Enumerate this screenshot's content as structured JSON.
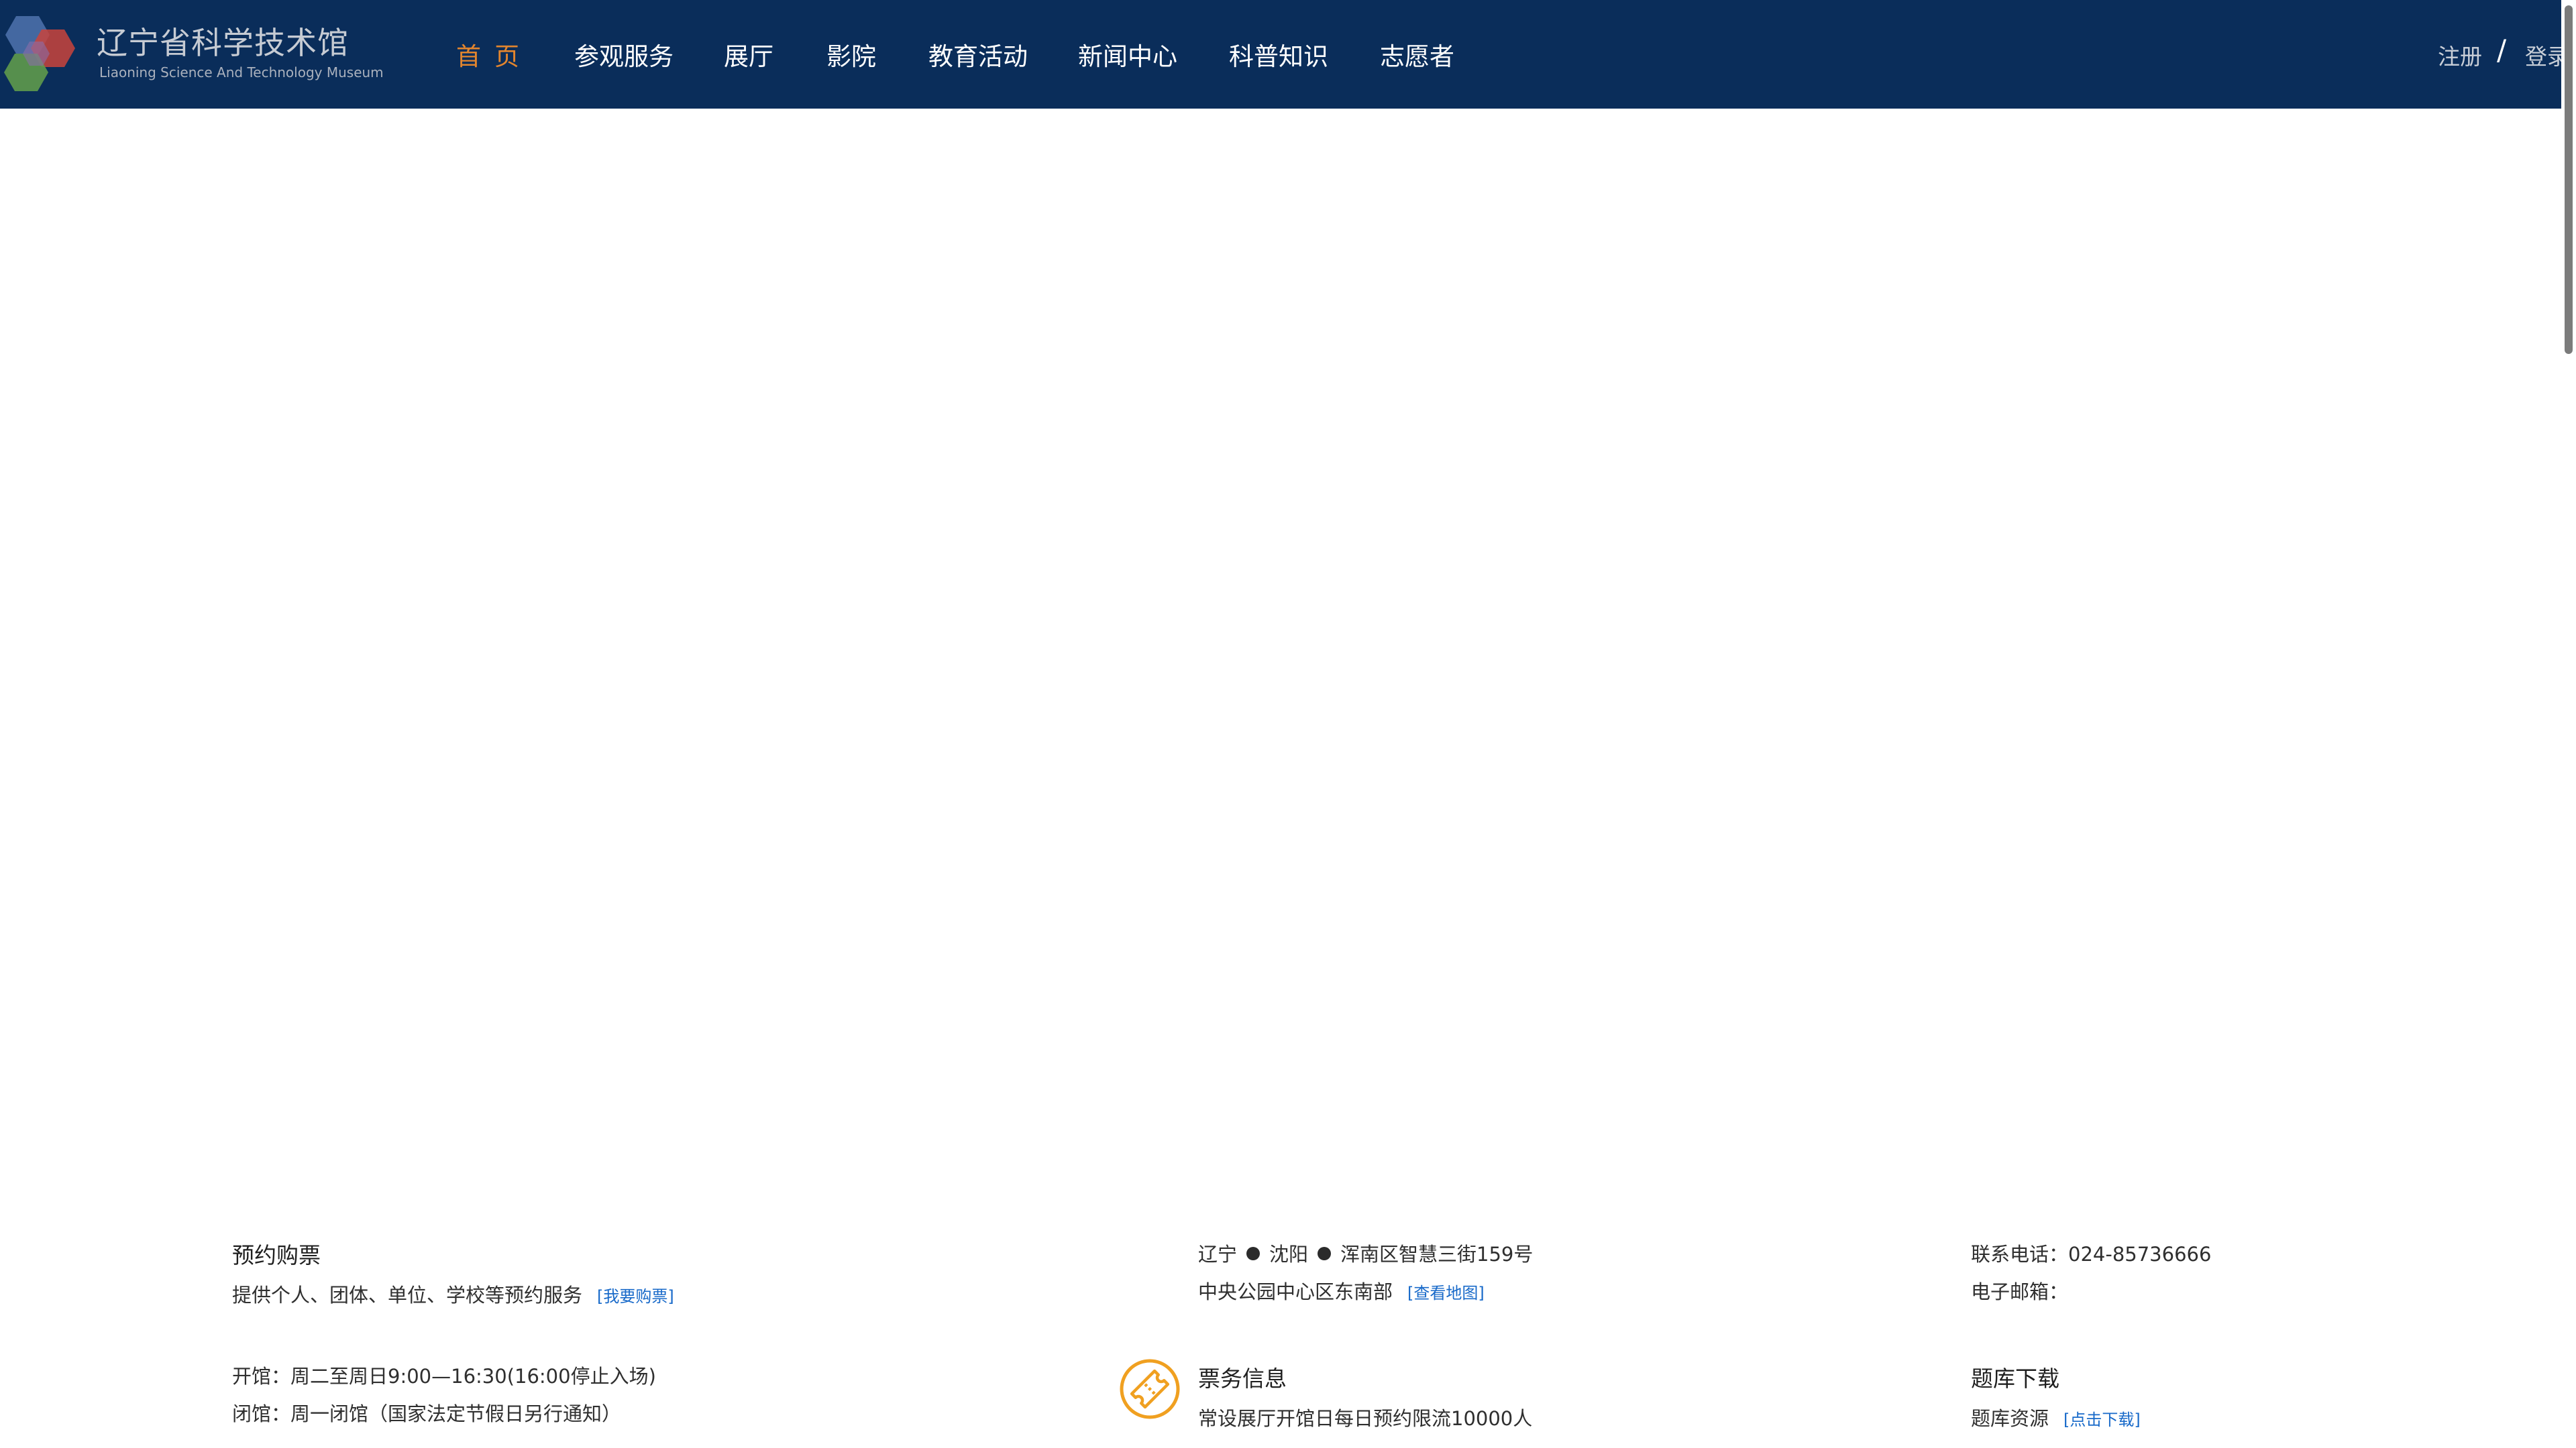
{
  "header": {
    "logo_title": "辽宁省科学技术馆",
    "logo_subtitle": "Liaoning Science And Technology Museum",
    "nav": [
      {
        "label": "首页"
      },
      {
        "label": "参观服务"
      },
      {
        "label": "展厅"
      },
      {
        "label": "影院"
      },
      {
        "label": "教育活动"
      },
      {
        "label": "新闻中心"
      },
      {
        "label": "科普知识"
      },
      {
        "label": "志愿者"
      }
    ],
    "register": "注册",
    "separator": "/",
    "login": "登录"
  },
  "footer": {
    "booking": {
      "title": "预约购票",
      "desc": "提供个人、团体、单位、学校等预约服务",
      "link": "[我要购票]"
    },
    "address": {
      "province": "辽宁",
      "city": "沈阳",
      "street": "浑南区智慧三街159号",
      "area": "中央公园中心区东南部",
      "map_link": "[查看地图]"
    },
    "contact": {
      "phone": "联系电话：024-85736666",
      "email": "电子邮箱："
    },
    "hours": {
      "open": "开馆：周二至周日9:00—16:30(16:00停止入场)",
      "closed": "闭馆：周一闭馆（国家法定节假日另行通知）"
    },
    "ticket": {
      "icon": "ticket-icon",
      "title": "票务信息",
      "desc": "常设展厅开馆日每日预约限流10000人"
    },
    "question_bank": {
      "title": "题库下载",
      "label": "题库资源",
      "link": "[点击下载]"
    }
  },
  "colors": {
    "header_bg": "#0a2d5a",
    "nav_active": "#e2852e",
    "link": "#1769c9",
    "icon": "#f0a020"
  }
}
